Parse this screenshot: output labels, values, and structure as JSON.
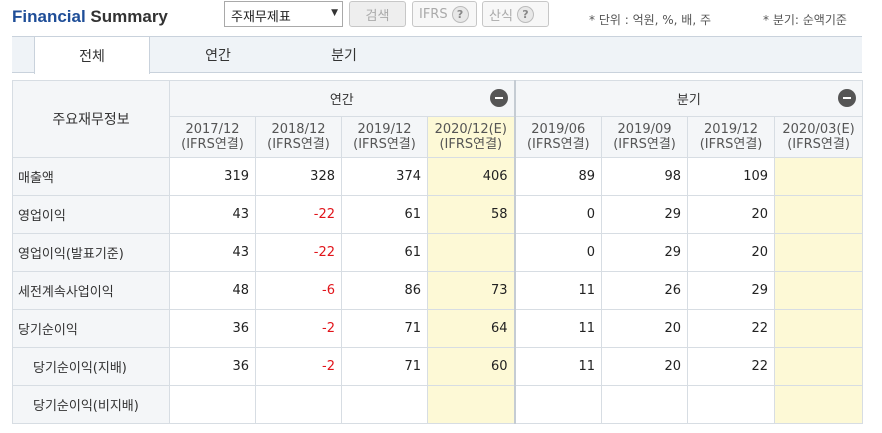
{
  "header": {
    "title_part1": "Financial",
    "title_part2": " Summary",
    "select_value": "주재무제표",
    "select_arrow": "▼",
    "search_label": "검색",
    "ifrs_label": "IFRS",
    "calc_label": "산식",
    "help_glyph": "?",
    "note_unit": "* 단위 : 억원, %, 배, 주",
    "note_quarter": "* 분기: 순액기준"
  },
  "tabs": [
    {
      "label": "전체",
      "active": true
    },
    {
      "label": "연간",
      "active": false
    },
    {
      "label": "분기",
      "active": false
    }
  ],
  "table": {
    "corner_label": "주요재무정보",
    "group_annual": "연간",
    "group_quarter": "분기",
    "periods": [
      {
        "period": "2017/12",
        "basis": "(IFRS연결)"
      },
      {
        "period": "2018/12",
        "basis": "(IFRS연결)"
      },
      {
        "period": "2019/12",
        "basis": "(IFRS연결)"
      },
      {
        "period": "2020/12(E)",
        "basis": "(IFRS연결)"
      },
      {
        "period": "2019/06",
        "basis": "(IFRS연결)"
      },
      {
        "period": "2019/09",
        "basis": "(IFRS연결)"
      },
      {
        "period": "2019/12",
        "basis": "(IFRS연결)"
      },
      {
        "period": "2020/03(E)",
        "basis": "(IFRS연결)"
      }
    ],
    "rows": [
      {
        "label": "매출액",
        "values": [
          "319",
          "328",
          "374",
          "406",
          "89",
          "98",
          "109",
          ""
        ]
      },
      {
        "label": "영업이익",
        "values": [
          "43",
          "-22",
          "61",
          "58",
          "0",
          "29",
          "20",
          ""
        ]
      },
      {
        "label": "영업이익(발표기준)",
        "values": [
          "43",
          "-22",
          "61",
          "",
          "0",
          "29",
          "20",
          ""
        ]
      },
      {
        "label": "세전계속사업이익",
        "values": [
          "48",
          "-6",
          "86",
          "73",
          "11",
          "26",
          "29",
          ""
        ]
      },
      {
        "label": "당기순이익",
        "values": [
          "36",
          "-2",
          "71",
          "64",
          "11",
          "20",
          "22",
          ""
        ]
      },
      {
        "label": "당기순이익(지배)",
        "values": [
          "36",
          "-2",
          "71",
          "60",
          "11",
          "20",
          "22",
          ""
        ]
      },
      {
        "label": "당기순이익(비지배)",
        "values": [
          "",
          "",
          "",
          "",
          "",
          "",
          "",
          ""
        ]
      }
    ]
  },
  "colors": {
    "brand_blue": "#1f4e98",
    "negative_red": "#e1141a",
    "estimate_yellow": "#fdf9d6"
  }
}
